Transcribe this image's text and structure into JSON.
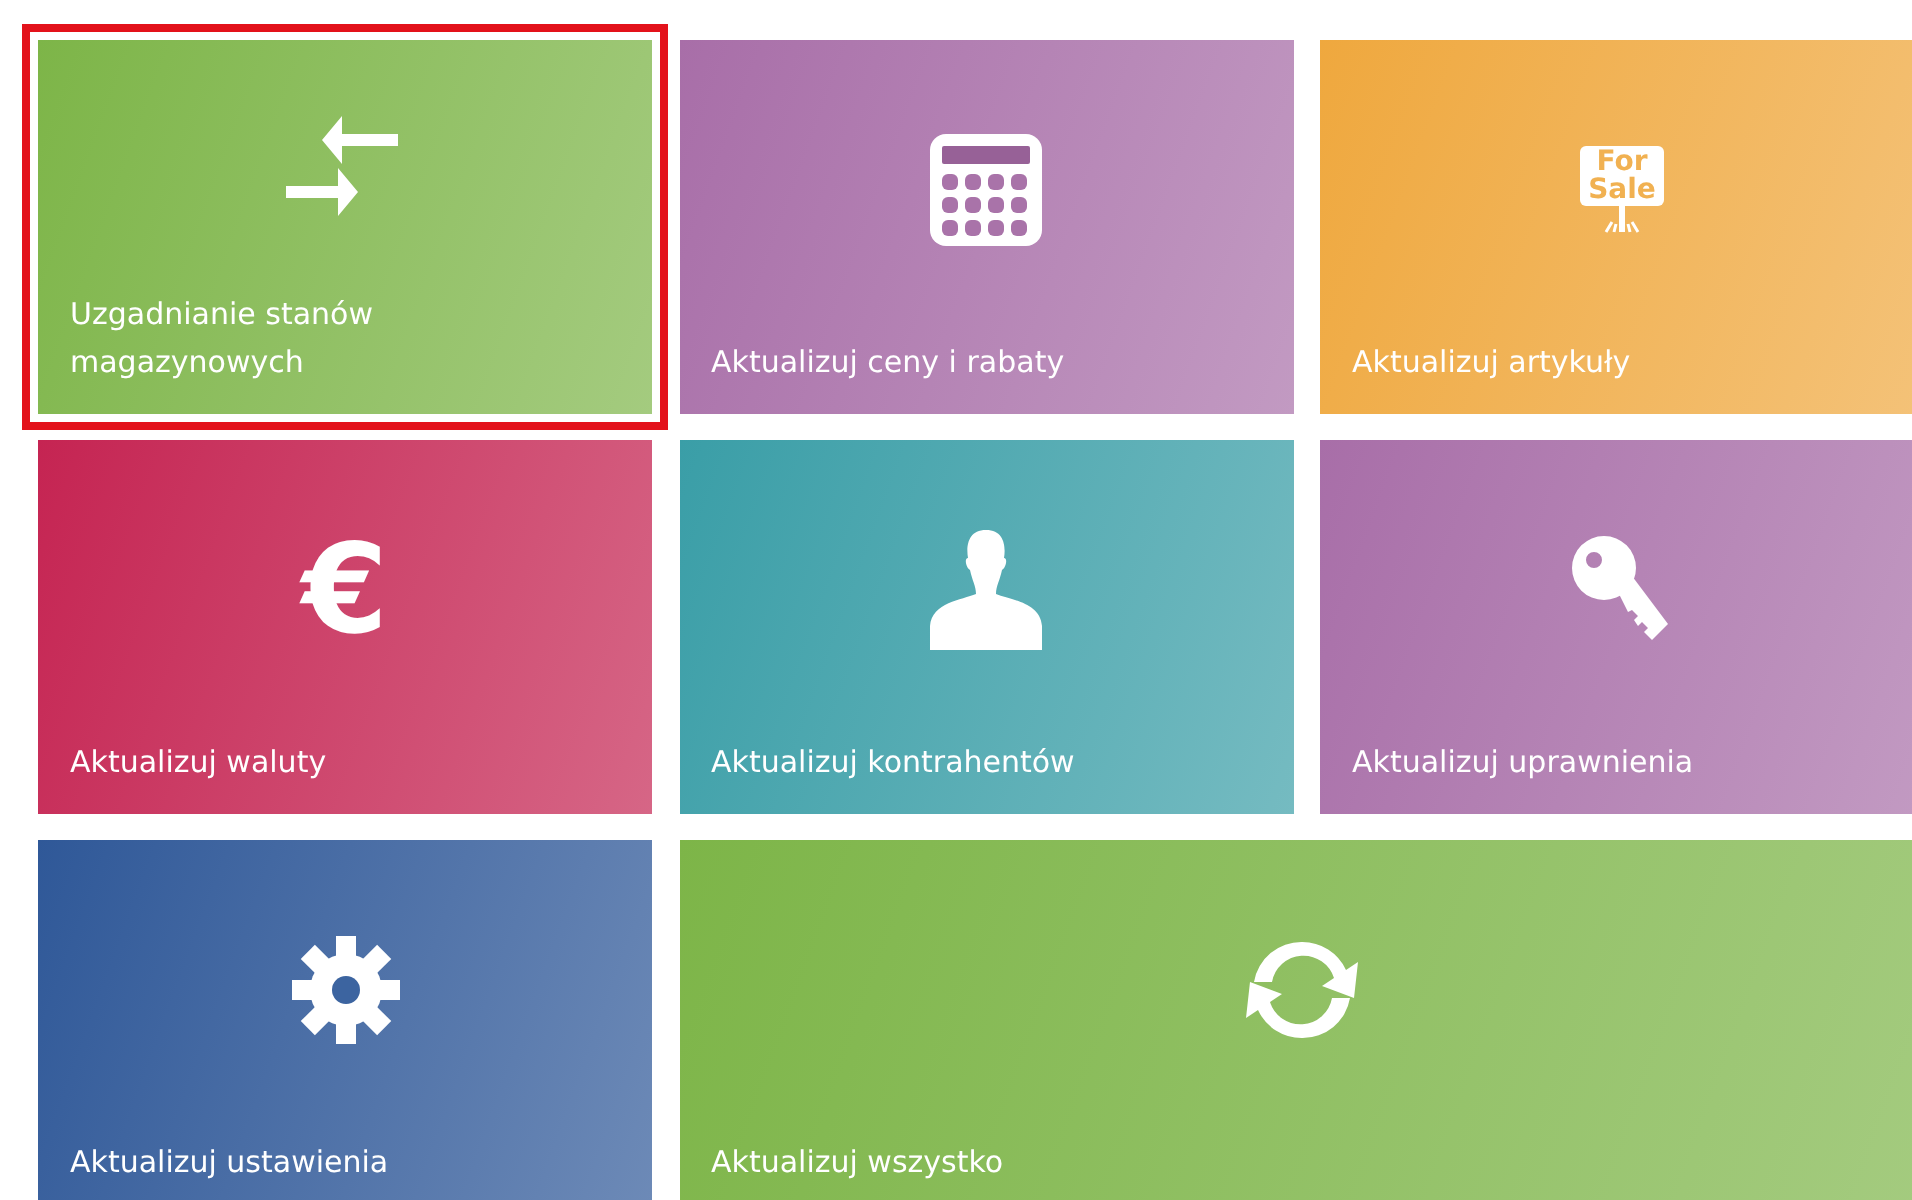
{
  "tiles": [
    {
      "label": "Uzgadnianie stanów magazynowych",
      "kind": "arrows",
      "color": "#7db548",
      "selected": true,
      "wide": false
    },
    {
      "label": "Aktualizuj ceny i rabaty",
      "kind": "calculator",
      "color": "#a86ea8",
      "selected": false,
      "wide": false
    },
    {
      "label": "Aktualizuj artykuły",
      "kind": "sign",
      "sign_text": [
        "For",
        "Sale"
      ],
      "color": "#efa83e",
      "selected": false,
      "wide": false
    },
    {
      "label": "Aktualizuj waluty",
      "kind": "glyph",
      "glyph": "€",
      "color": "#c52452",
      "selected": false,
      "wide": false
    },
    {
      "label": "Aktualizuj kontrahentów",
      "kind": "person",
      "color": "#3a9ea7",
      "selected": false,
      "wide": false
    },
    {
      "label": "Aktualizuj uprawnienia",
      "kind": "key",
      "color": "#a86ea8",
      "selected": false,
      "wide": false
    },
    {
      "label": "Aktualizuj ustawienia",
      "kind": "gear",
      "color": "#2f5898",
      "selected": false,
      "wide": false
    },
    {
      "label": "Aktualizuj wszystko",
      "kind": "refresh",
      "color": "#7db548",
      "selected": false,
      "wide": true
    }
  ]
}
